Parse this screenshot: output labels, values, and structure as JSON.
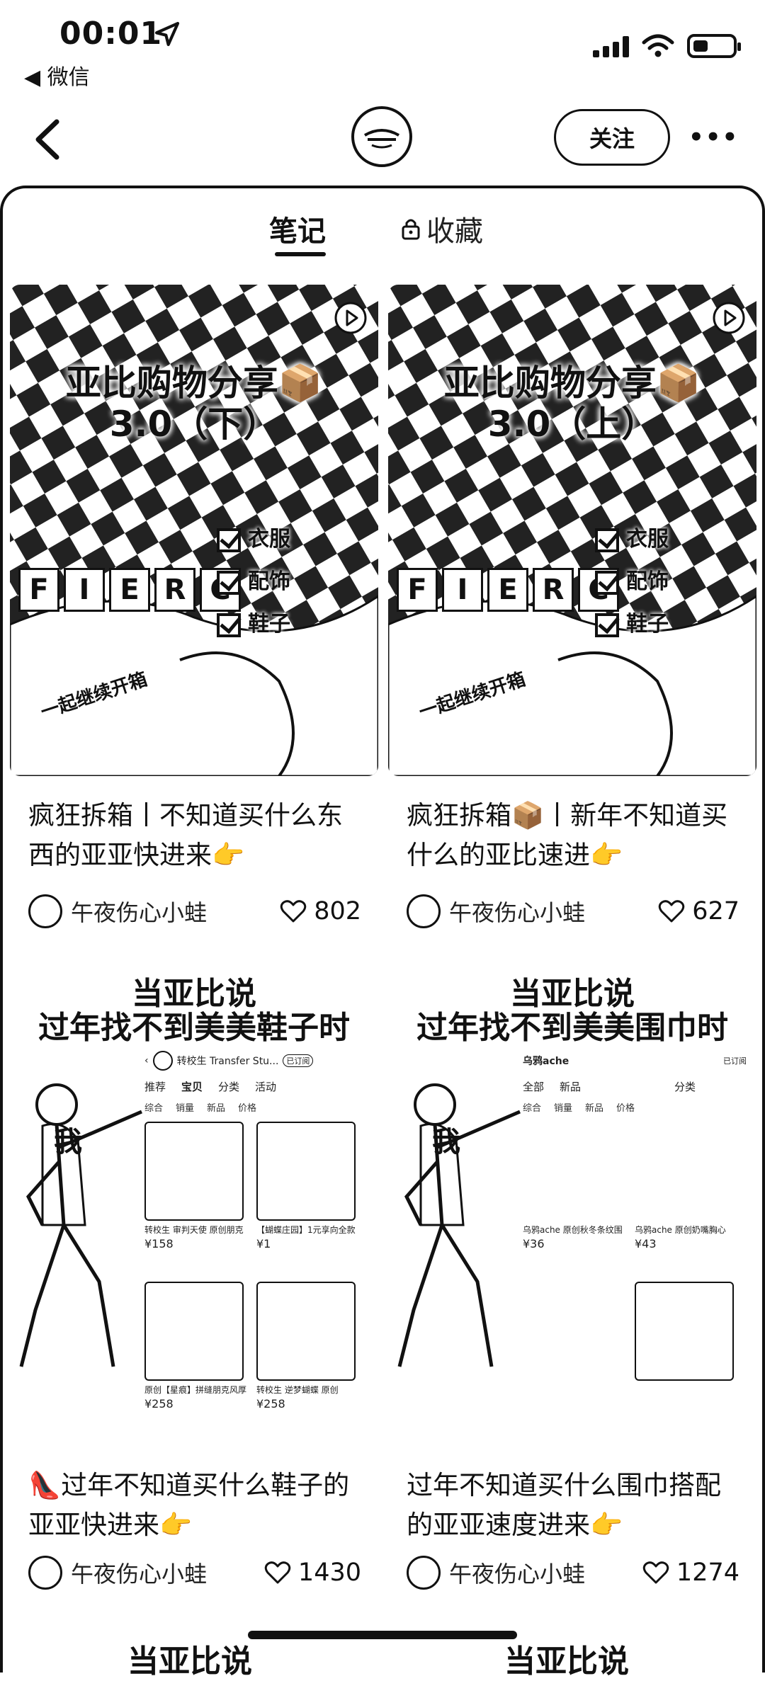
{
  "status": {
    "time": "00:01",
    "back_app": "◀ 微信"
  },
  "nav": {
    "follow_label": "关注",
    "more_label": "•••"
  },
  "tabs": {
    "notes": "笔记",
    "favorites": "收藏"
  },
  "posts": [
    {
      "cover_title": "亚比购物分享📦\n3.0（下）",
      "checklist": [
        "衣服",
        "配饰",
        "鞋子"
      ],
      "cover_word": "FIERC",
      "handwriting": "一起继续开箱",
      "title": "疯狂拆箱丨不知道买什么东西的亚亚快进来👉",
      "author": "午夜伤心小蛙",
      "likes": "802"
    },
    {
      "cover_title": "亚比购物分享📦\n3.0（上）",
      "checklist": [
        "衣服",
        "配饰",
        "鞋子"
      ],
      "cover_word": "FIERC",
      "handwriting": "一起继续开箱",
      "title": "疯狂拆箱📦丨新年不知道买什么的亚比速进👉",
      "author": "午夜伤心小蛙",
      "likes": "627"
    },
    {
      "meme_title": "当亚比说\n过年找不到美美鞋子时",
      "meme_label": "我",
      "shop": {
        "name": "转校生 Transfer Stu...",
        "subscribed": "已订阅",
        "tabs": [
          "推荐",
          "宝贝",
          "分类",
          "活动"
        ],
        "sort": [
          "综合",
          "销量",
          "新品",
          "价格"
        ],
        "products": [
          {
            "name": "转校生 审判天使 原创朋克",
            "price": "¥158"
          },
          {
            "name": "【蝴蝶庄园】1元享向全款",
            "price": "¥1"
          },
          {
            "name": "原创【星痕】拼缝朋克风厚",
            "price": "¥258"
          },
          {
            "name": "转校生 逆梦蝴蝶 原创",
            "price": "¥258"
          }
        ]
      },
      "title": "👠过年不知道买什么鞋子的亚亚快进来👉",
      "author": "午夜伤心小蛙",
      "likes": "1430"
    },
    {
      "meme_title": "当亚比说\n过年找不到美美围巾时",
      "meme_label": "我",
      "shop": {
        "name": "乌鸦ache",
        "subscribed": "已订阅",
        "tabs": [
          "全部",
          "新品",
          "分类"
        ],
        "sort": [
          "综合",
          "销量",
          "新品",
          "价格"
        ],
        "products": [
          {
            "name": "乌鸦ache 原创秋冬条纹围",
            "price": "¥36"
          },
          {
            "name": "乌鸦ache 原创奶嘴胸心",
            "price": "¥43"
          },
          {
            "name": "",
            "price": ""
          },
          {
            "name": "",
            "price": ""
          }
        ]
      },
      "title": "过年不知道买什么围巾搭配的亚亚速度进来👉",
      "author": "午夜伤心小蛙",
      "likes": "1274"
    }
  ],
  "peek": [
    "当亚比说",
    "当亚比说"
  ]
}
